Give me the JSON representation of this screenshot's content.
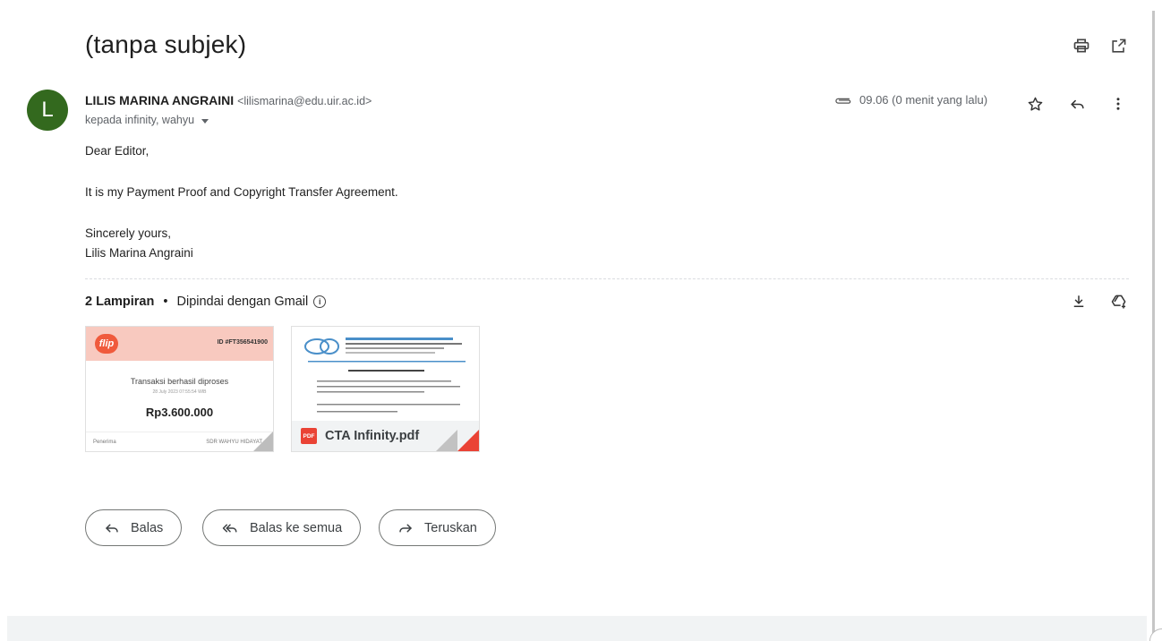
{
  "email": {
    "subject": "(tanpa subjek)",
    "sender_initial": "L",
    "sender_name": "LILIS MARINA ANGRAINI",
    "sender_email": "<lilismarina@edu.uir.ac.id>",
    "recipients": "kepada infinity, wahyu",
    "time": "09.06 (0 menit yang lalu)",
    "avatar_color": "#33691e",
    "body_lines": [
      "Dear Editor,",
      "It is my Payment Proof and Copyright Transfer Agreement.",
      "Sincerely yours,",
      "Lilis Marina Angraini"
    ]
  },
  "attachments": {
    "count_label": "2 Lampiran",
    "scan_label": "Dipindai dengan Gmail",
    "items": [
      {
        "logo": "flip",
        "id": "ID #FT356541900",
        "status": "Transaksi berhasil diproses",
        "date": "28 July 2023 07:55:54 WIB",
        "amount": "Rp3.600.000",
        "footer_left": "Penerima",
        "footer_right": "SDR WAHYU HIDAYAT"
      },
      {
        "badge": "PDF",
        "name": "CTA Infinity.pdf"
      }
    ]
  },
  "actions": {
    "reply": "Balas",
    "reply_all": "Balas ke semua",
    "forward": "Teruskan"
  },
  "icons": {
    "print": "print-icon",
    "open_new": "open-in-new-icon",
    "attachment": "paperclip-icon",
    "star": "star-icon",
    "reply": "reply-icon",
    "more": "more-vert-icon",
    "download": "download-icon",
    "drive": "add-to-drive-icon"
  },
  "colors": {
    "flip_brand": "#f05a3c",
    "pdf_red": "#ea4335"
  }
}
